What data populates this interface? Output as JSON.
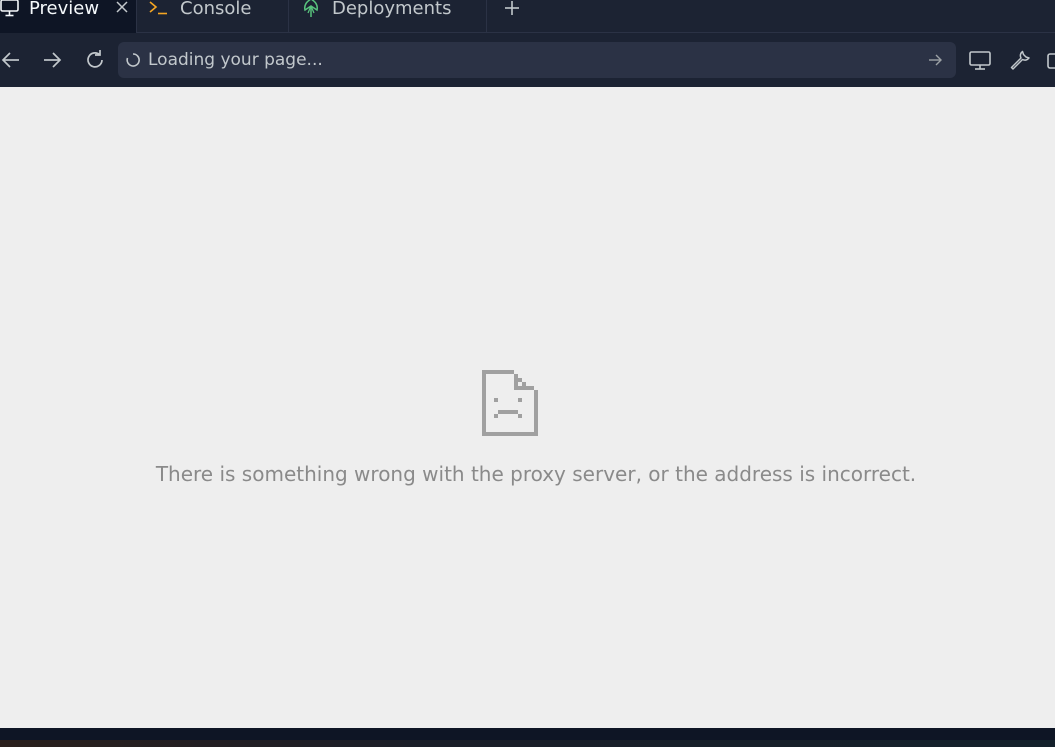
{
  "tabs": [
    {
      "label": "Preview",
      "icon": "monitor-icon",
      "active": true
    },
    {
      "label": "Console",
      "icon": "terminal-icon",
      "active": false
    },
    {
      "label": "Deployments",
      "icon": "deployments-icon",
      "active": false
    }
  ],
  "addressbar": {
    "status_text": "Loading your page..."
  },
  "error": {
    "message": "There is something wrong with the proxy server, or the address is incorrect.",
    "icon": "sad-page-icon"
  },
  "colors": {
    "chrome_bg": "#1c2333",
    "active_tab_bg": "#0e1525",
    "content_bg": "#eeeeee",
    "error_text": "#8a8a8a",
    "deploy_icon": "#58c27d"
  }
}
